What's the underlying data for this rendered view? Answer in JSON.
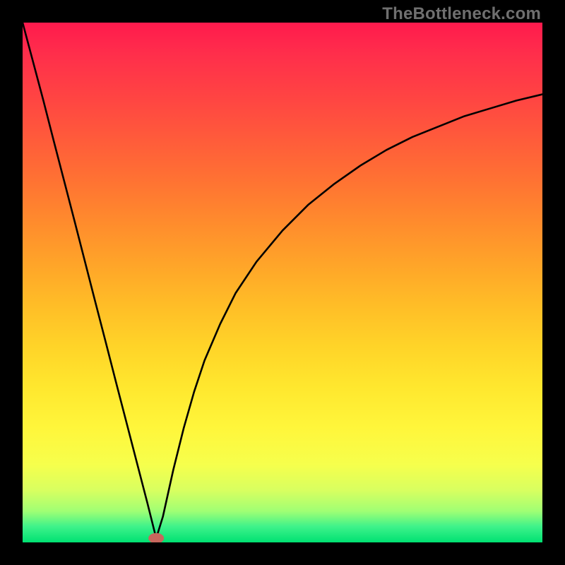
{
  "attribution": "TheBottleneck.com",
  "chart_data": {
    "type": "line",
    "title": "",
    "xlabel": "",
    "ylabel": "",
    "xlim": [
      0,
      100
    ],
    "ylim": [
      0,
      100
    ],
    "grid": false,
    "legend": false,
    "series": [
      {
        "name": "left-branch",
        "x": [
          0,
          2,
          4,
          6,
          8,
          10,
          12,
          14,
          16,
          18,
          20,
          22,
          24,
          25.7
        ],
        "y": [
          100,
          92.5,
          85,
          77.2,
          69.5,
          61.8,
          54,
          46.2,
          38.5,
          30.7,
          23,
          15.3,
          7.6,
          0.8
        ]
      },
      {
        "name": "right-branch",
        "x": [
          25.7,
          27,
          29,
          31,
          33,
          35,
          38,
          41,
          45,
          50,
          55,
          60,
          65,
          70,
          75,
          80,
          85,
          90,
          95,
          100
        ],
        "y": [
          0.8,
          5,
          14,
          22,
          29,
          35,
          42,
          48,
          54,
          60,
          65,
          69,
          72.5,
          75.5,
          78,
          80,
          82,
          83.5,
          85,
          86.2
        ]
      }
    ],
    "marker": {
      "x": 25.7,
      "y": 0.8,
      "rx": 1.5,
      "ry": 1.0
    }
  },
  "colors": {
    "background_black": "#000000",
    "curve": "#000000",
    "marker": "#c7675d",
    "gradient_top": "#ff1a4d",
    "gradient_bottom": "#00e172",
    "attribution": "#6f6f6f"
  }
}
